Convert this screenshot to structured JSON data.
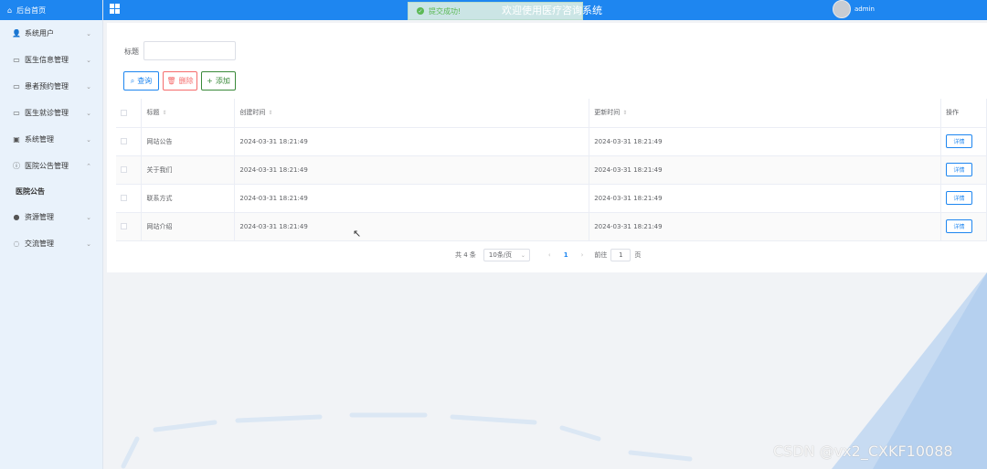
{
  "sidebar": {
    "home_label": "后台首页",
    "items": [
      {
        "label": "系统用户",
        "icon": "user-icon"
      },
      {
        "label": "医生信息管理",
        "icon": "document-icon"
      },
      {
        "label": "患者预约管理",
        "icon": "document-icon"
      },
      {
        "label": "医生就诊管理",
        "icon": "document-icon"
      },
      {
        "label": "系统管理",
        "icon": "image-icon"
      },
      {
        "label": "医院公告管理",
        "icon": "info-icon"
      }
    ],
    "active_sub": "医院公告",
    "items_after": [
      {
        "label": "资源管理",
        "icon": "dot-icon"
      },
      {
        "label": "交流管理",
        "icon": "chat-icon"
      }
    ]
  },
  "header": {
    "title": "欢迎使用医疗咨询系统",
    "username": "admin",
    "toast": "提交成功!"
  },
  "filter": {
    "title_label": "标题",
    "title_value": ""
  },
  "toolbar": {
    "query_label": "查询",
    "delete_label": "删除",
    "add_label": "添加"
  },
  "table": {
    "columns": [
      "标题",
      "创建时间",
      "更新时间",
      "操作"
    ],
    "rows": [
      {
        "title": "网站公告",
        "created": "2024-03-31 18:21:49",
        "updated": "2024-03-31 18:21:49",
        "action": "详情"
      },
      {
        "title": "关于我们",
        "created": "2024-03-31 18:21:49",
        "updated": "2024-03-31 18:21:49",
        "action": "详情"
      },
      {
        "title": "联系方式",
        "created": "2024-03-31 18:21:49",
        "updated": "2024-03-31 18:21:49",
        "action": "详情"
      },
      {
        "title": "网站介绍",
        "created": "2024-03-31 18:21:49",
        "updated": "2024-03-31 18:21:49",
        "action": "详情"
      }
    ]
  },
  "pagination": {
    "total": "共 4 条",
    "page_size": "10条/页",
    "current_page": "1",
    "goto_label": "前往",
    "goto_value": "1",
    "page_suffix": "页"
  },
  "watermark": "CSDN @vx2_CXKF10088",
  "colors": {
    "primary": "#1e86f0",
    "danger": "#f56c6c",
    "success": "#67c23a"
  }
}
